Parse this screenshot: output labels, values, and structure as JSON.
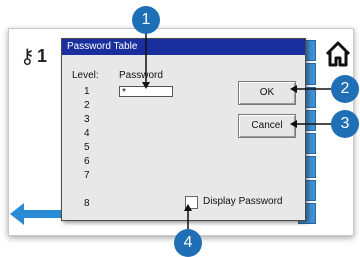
{
  "status": {
    "key_icon": "key-icon",
    "key_count": "1"
  },
  "nav": {
    "home_icon": "home-icon",
    "back_icon": "back-arrow-icon"
  },
  "dialog": {
    "title": "Password Table",
    "col_level": "Level:",
    "col_password": "Password",
    "levels": [
      "1",
      "2",
      "3",
      "4",
      "5",
      "6",
      "7",
      "8"
    ],
    "password_value": "*",
    "ok_label": "OK",
    "cancel_label": "Cancel",
    "display_password_label": "Display Password",
    "display_password_checked": false
  },
  "callouts": [
    "1",
    "2",
    "3",
    "4"
  ],
  "colors": {
    "titlebar": "#1a2f9e",
    "callout": "#1e6fb5",
    "tab": "#3f8fd1"
  }
}
